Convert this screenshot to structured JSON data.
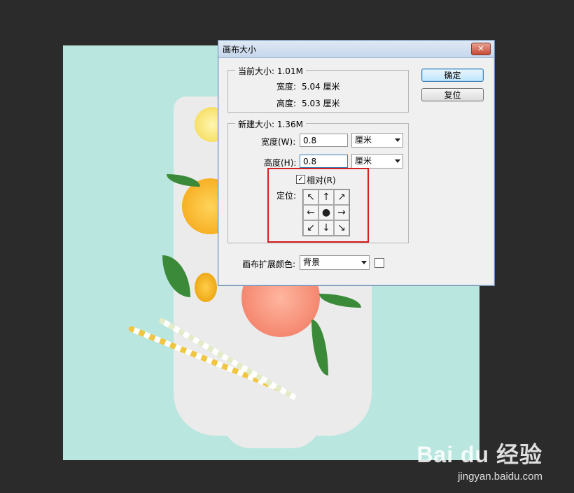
{
  "dialog": {
    "title": "画布大小",
    "close_label": "✕",
    "current_size": {
      "legend": "当前大小: 1.01M",
      "width_label": "宽度:",
      "width_value": "5.04 厘米",
      "height_label": "高度:",
      "height_value": "5.03 厘米"
    },
    "new_size": {
      "legend": "新建大小: 1.36M",
      "width_label": "宽度(W):",
      "width_value": "0.8",
      "width_unit": "厘米",
      "height_label": "高度(H):",
      "height_value": "0.8",
      "height_unit": "厘米",
      "relative_label": "相对(R)",
      "relative_checked": "✓",
      "anchor_label": "定位:",
      "anchor_cells": [
        "↖",
        "↑",
        "↗",
        "←",
        "●",
        "→",
        "↙",
        "↓",
        "↘"
      ]
    },
    "extension_color_label": "画布扩展颜色:",
    "extension_color_value": "背景",
    "ok_label": "确定",
    "reset_label": "复位"
  },
  "watermark": {
    "main": "Bai du 经验",
    "sub": "jingyan.baidu.com"
  },
  "colors": {
    "canvas_bg": "#b9e6df",
    "highlight_border": "#d42020"
  }
}
